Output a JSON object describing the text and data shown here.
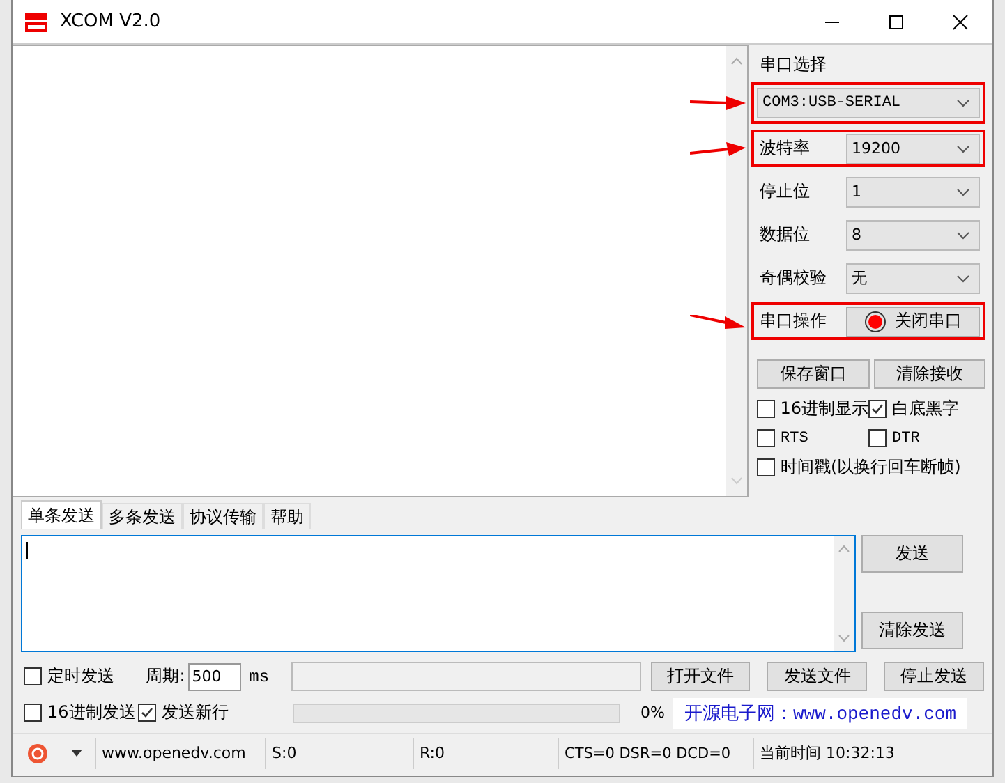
{
  "window": {
    "title": "XCOM V2.0"
  },
  "serial_panel": {
    "section_label": "串口选择",
    "port": {
      "value": "COM3:USB-SERIAL",
      "highlighted": true
    },
    "settings": [
      {
        "label": "波特率",
        "value": "19200",
        "highlighted": true
      },
      {
        "label": "停止位",
        "value": "1",
        "highlighted": false
      },
      {
        "label": "数据位",
        "value": "8",
        "highlighted": false
      },
      {
        "label": "奇偶校验",
        "value": "无",
        "highlighted": false
      }
    ],
    "operation": {
      "label": "串口操作",
      "button": "关闭串口",
      "open": true,
      "highlighted": true
    },
    "buttons": [
      "保存窗口",
      "清除接收"
    ],
    "options": [
      {
        "label": "16进制显示",
        "checked": false
      },
      {
        "label": "白底黑字",
        "checked": true
      },
      {
        "label": "RTS",
        "checked": false
      },
      {
        "label": "DTR",
        "checked": false
      },
      {
        "label": "时间戳(以换行回车断帧)",
        "checked": false
      }
    ]
  },
  "tabs": [
    {
      "label": "单条发送",
      "selected": true
    },
    {
      "label": "多条发送",
      "selected": false
    },
    {
      "label": "协议传输",
      "selected": false
    },
    {
      "label": "帮助",
      "selected": false
    }
  ],
  "send_buttons": [
    "发送",
    "清除发送"
  ],
  "timer": {
    "label": "定时发送",
    "checked": false
  },
  "period": {
    "label": "周期:",
    "value": "500",
    "unit": "ms"
  },
  "file_buttons": [
    "打开文件",
    "发送文件",
    "停止发送"
  ],
  "send_options": [
    {
      "label": "16进制发送",
      "checked": false
    },
    {
      "label": "发送新行",
      "checked": true
    }
  ],
  "progress": {
    "level": 0,
    "reading": "0%"
  },
  "banner": "开源电子网：www.openedv.com",
  "status_bar": {
    "url": "www.openedv.com",
    "sent": "S:0",
    "received": "R:0",
    "lines": "CTS=0 DSR=0 DCD=0",
    "time": "当前时间 10:32:13"
  }
}
